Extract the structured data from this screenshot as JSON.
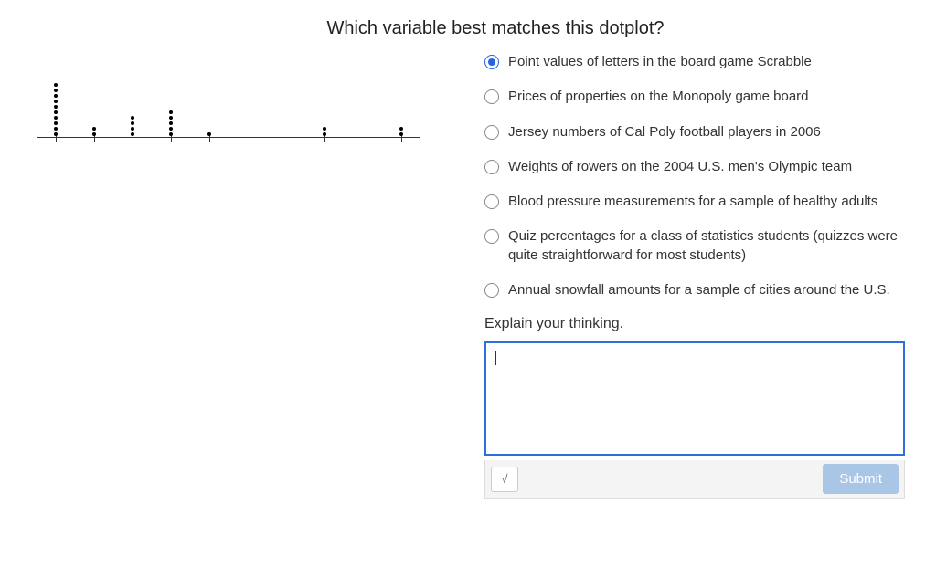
{
  "question": {
    "title": "Which variable best matches this dotplot?",
    "explain_label": "Explain your thinking.",
    "options": [
      {
        "label": "Point values of letters in the board game Scrabble",
        "selected": true
      },
      {
        "label": "Prices of properties on the Monopoly game board",
        "selected": false
      },
      {
        "label": "Jersey numbers of Cal Poly football players in 2006",
        "selected": false
      },
      {
        "label": "Weights of rowers on the 2004 U.S. men's Olympic team",
        "selected": false
      },
      {
        "label": "Blood pressure measurements for a sample of healthy adults",
        "selected": false
      },
      {
        "label": "Quiz percentages for a class of statistics students (quizzes were quite straightforward for most students)",
        "selected": false
      },
      {
        "label": "Annual snowfall amounts for a sample of cities around the U.S.",
        "selected": false
      }
    ]
  },
  "chart_data": {
    "type": "dotplot",
    "x_values": [
      1,
      2,
      3,
      4,
      5,
      8,
      10
    ],
    "counts": [
      10,
      2,
      4,
      5,
      1,
      2,
      2
    ],
    "xlim": [
      0.5,
      10.5
    ],
    "xlabel": "",
    "ylabel": ""
  },
  "toolbar": {
    "math_icon": "√",
    "submit_label": "Submit"
  },
  "textarea": {
    "value": ""
  }
}
